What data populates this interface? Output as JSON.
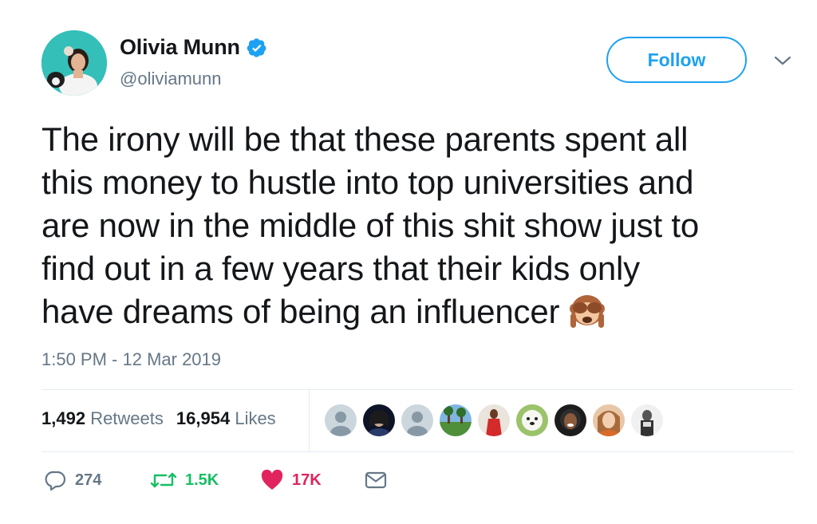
{
  "user": {
    "display_name": "Olivia Munn",
    "handle": "@oliviamunn",
    "verified": true,
    "verified_icon": "verified-badge-icon",
    "avatar_icon": "profile-avatar"
  },
  "header": {
    "follow_label": "Follow",
    "more_icon": "chevron-down-icon"
  },
  "tweet": {
    "lines": [
      "The irony will be that these parents spent all",
      "this money to hustle into top universities and",
      "are now in the middle of this shit show just to",
      "find out in a few years that their kids only",
      "have dreams of being an influencer"
    ],
    "emoji": "see-no-evil-monkey-icon",
    "timestamp": "1:50 PM - 12 Mar 2019"
  },
  "stats": {
    "retweets_count": "1,492",
    "retweets_label": "Retweets",
    "likes_count": "16,954",
    "likes_label": "Likes"
  },
  "likers": [
    "default-avatar",
    "avatar-dark-hair",
    "default-avatar",
    "avatar-beach",
    "avatar-red-dress",
    "avatar-dog",
    "avatar-curly-hair",
    "avatar-smiling-woman",
    "avatar-man"
  ],
  "actions": {
    "reply_count": "274",
    "retweet_count": "1.5K",
    "like_count": "17K",
    "reply_icon": "reply-icon",
    "retweet_icon": "retweet-icon",
    "like_icon": "heart-icon",
    "dm_icon": "envelope-icon"
  },
  "colors": {
    "accent": "#1da1f2",
    "muted": "#657786",
    "retweet_green": "#17bf63",
    "like_red": "#e0245e",
    "text": "#14171a"
  }
}
